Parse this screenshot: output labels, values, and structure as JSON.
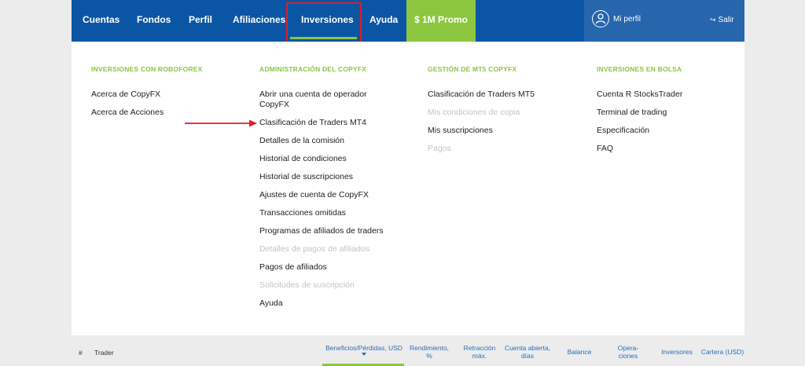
{
  "nav": {
    "items": [
      "Cuentas",
      "Fondos",
      "Perfil",
      "Afiliaciones",
      "Inversiones",
      "Ayuda"
    ],
    "promo": "$ 1M Promo",
    "profile": "Mi perfil",
    "logout": "Salir",
    "accent_color": "#8cc63f",
    "bar_color": "#0b56a4"
  },
  "menu": {
    "columns": [
      {
        "title": "INVERSIONES CON ROBOFOREX",
        "items": [
          "Acerca de CopyFX",
          "Acerca de Acciones"
        ]
      },
      {
        "title": "ADMINISTRACIÓN DEL COPYFX",
        "items": [
          "Abrir una cuenta de operador CopyFX",
          "Clasificación de Traders MT4",
          "Detalles de la comisión",
          "Historial de condiciones",
          "Historial de suscripciones",
          "Ajustes de cuenta de CopyFX",
          "Transacciones omitidas",
          "Programas de afiliados de traders",
          "Detalles de pagos de afiliados",
          "Pagos de afiliados",
          "Solicitudes de suscripción",
          "Ayuda"
        ]
      },
      {
        "title": "GESTIÓN DE MT5 COPYFX",
        "items": [
          "Clasificación de Traders MT5",
          "Mis condiciones de copia",
          "Mis suscripciones",
          "Pagos"
        ]
      },
      {
        "title": "INVERSIONES EN BOLSA",
        "items": [
          "Cuenta R StocksTrader",
          "Terminal de trading",
          "Especificación",
          "FAQ"
        ]
      }
    ]
  },
  "table": {
    "headers": [
      "#",
      "Trader",
      "Beneficios/Pérdidas, USD",
      "Rendimiento, %",
      "Retracción máx.",
      "Cuenta abierta, días",
      "Balance",
      "Operaciones",
      "Inversores",
      "Cartera (USD)"
    ],
    "headers_lines": {
      "h3a": "Rendimiento,",
      "h3b": "%",
      "h4a": "Retracción",
      "h4b": "máx.",
      "h5a": "Cuenta abierta,",
      "h5b": "días",
      "h7a": "Opera-",
      "h7b": "ciones"
    }
  }
}
